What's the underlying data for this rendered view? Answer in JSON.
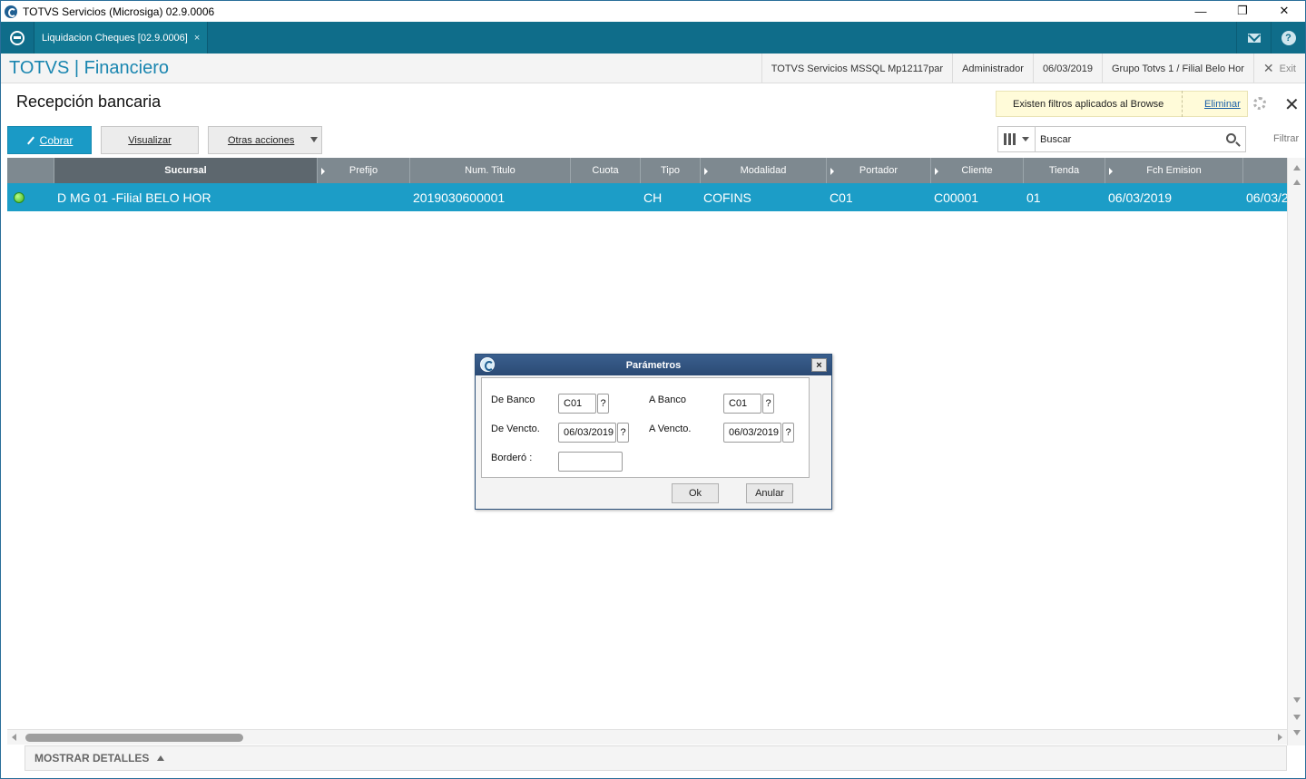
{
  "window": {
    "title": "TOTVS Servicios (Microsiga) 02.9.0006",
    "minimize": "—",
    "maximize": "❐",
    "close": "✕"
  },
  "tabs": [
    {
      "label": "Liquidacion Cheques [02.9.0006]",
      "close": "×"
    }
  ],
  "header": {
    "module": "TOTVS | Financiero",
    "server": "TOTVS Servicios MSSQL Mp12117par",
    "user": "Administrador",
    "date": "06/03/2019",
    "branch": "Grupo Totvs 1 / Filial Belo Hor",
    "exit": "Exit"
  },
  "page": {
    "title": "Recepción bancaria",
    "filter_notice": "Existen filtros aplicados al Browse",
    "filter_remove": "Eliminar"
  },
  "toolbar": {
    "cobrar": "Cobrar",
    "visualizar": "Visualizar",
    "otras_acciones": "Otras acciones",
    "search_value": "Buscar",
    "filtrar": "Filtrar"
  },
  "grid": {
    "columns": [
      "Sucursal",
      "Prefijo",
      "Num. Titulo",
      "Cuota",
      "Tipo",
      "Modalidad",
      "Portador",
      "Cliente",
      "Tienda",
      "Fch Emision"
    ],
    "rows": [
      {
        "sucursal": "D MG 01 -Filial BELO HOR",
        "prefijo": "",
        "num_titulo": "2019030600001",
        "cuota": "",
        "tipo": "CH",
        "modalidad": "COFINS",
        "portador": "C01",
        "cliente": "C00001",
        "tienda": "01",
        "fch_emision": "06/03/2019",
        "next": "06/03/2"
      }
    ],
    "status_color": "#3fb21f"
  },
  "details": {
    "label": "MOSTRAR DETALLES"
  },
  "dialog": {
    "title": "Parámetros",
    "de_banco_label": "De Banco",
    "de_banco": "C01",
    "a_banco_label": "A  Banco",
    "a_banco": "C01",
    "de_vencto_label": "De Vencto.",
    "de_vencto": "06/03/2019",
    "a_vencto_label": "A  Vencto.",
    "a_vencto": "06/03/2019",
    "bordero_label": "Borderó :",
    "bordero": "",
    "help": "?",
    "ok": "Ok",
    "anular": "Anular",
    "close": "×"
  },
  "colors": {
    "accent": "#1a9ac6",
    "tabbar": "#0f6d8a",
    "selected_row": "#1c9dc7",
    "grid_header": "#7e8990"
  }
}
